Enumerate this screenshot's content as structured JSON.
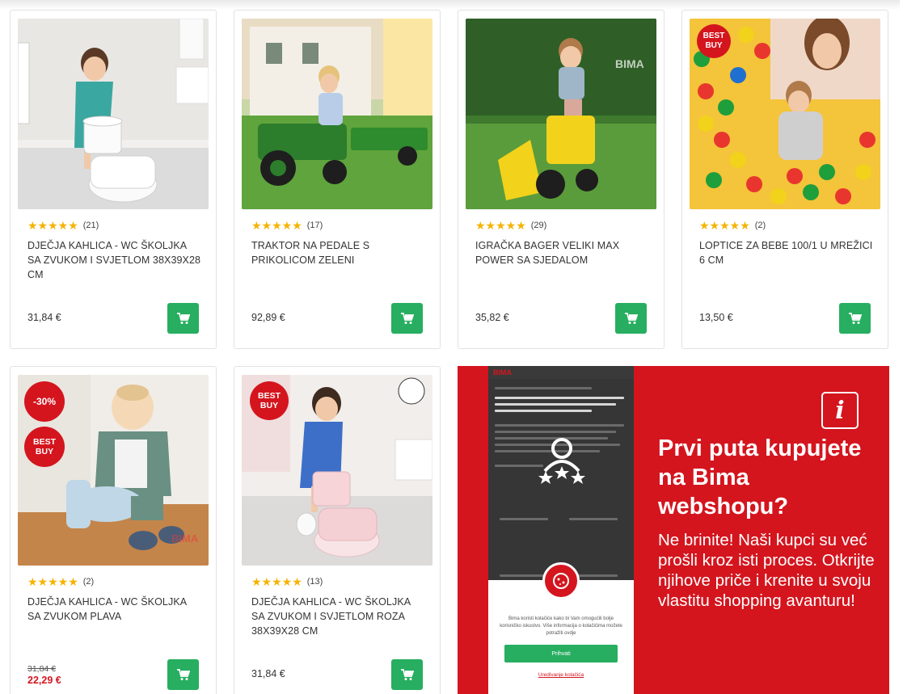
{
  "products": [
    {
      "title": "DJEČJA KAHLICA - WC ŠKOLJKA SA ZVUKOM I SVJETLOM 38x39x28 CM",
      "stars": "★★★★★",
      "reviews": "(21)",
      "price": "31,84 €"
    },
    {
      "title": "TRAKTOR NA PEDALE S PRIKOLICOM ZELENI",
      "stars": "★★★★★",
      "reviews": "(17)",
      "price": "92,89 €"
    },
    {
      "title": "IGRAČKA BAGER VELIKI MAX POWER SA SJEDALOM",
      "stars": "★★★★★",
      "reviews": "(29)",
      "price": "35,82 €",
      "watermark": "BIMA"
    },
    {
      "title": "LOPTICE ZA BEBE 100/1 U MREŽICI 6 CM",
      "stars": "★★★★★",
      "reviews": "(2)",
      "price": "13,50 €",
      "badge": "BEST BUY"
    },
    {
      "title": "DJEČJA KAHLICA - WC ŠKOLJKA SA ZVUKOM PLAVA",
      "stars": "★★★★★",
      "reviews": "(2)",
      "old_price": "31,84 €",
      "sale_price": "22,29 €",
      "discount": "-30%",
      "badge": "BEST BUY",
      "watermark": "BIMA"
    },
    {
      "title": "DJEČJA KAHLICA - WC ŠKOLJKA SA ZVUKOM I SVJETLOM ROZA 38x39x28 CM",
      "stars": "★★★★★",
      "reviews": "(13)",
      "price": "31,84 €",
      "badge": "BEST BUY"
    }
  ],
  "banner": {
    "headline": "Prvi puta kupujete na Bima webshopu?",
    "text": "Ne brinite! Naši kupci su već prošli kroz isti proces. Otkrijte njihove priče i krenite u svoju vlastitu shopping avanturu!",
    "phone_logo": "BIMA",
    "cookie_text": "Bima koristi kolačiće kako bi Vam omogućili bolje korisničko iskustvo. Više informacija o kolačićima možete potražiti ovdje",
    "accept_label": "Prihvati",
    "manage_label": "Uredivanje kolačića"
  },
  "icons": {
    "cart": "cart-icon",
    "info": "info-icon",
    "user_stars": "user-rating-icon"
  },
  "colors": {
    "accent_green": "#27ae60",
    "brand_red": "#d4151e",
    "star_gold": "#f5b301"
  }
}
